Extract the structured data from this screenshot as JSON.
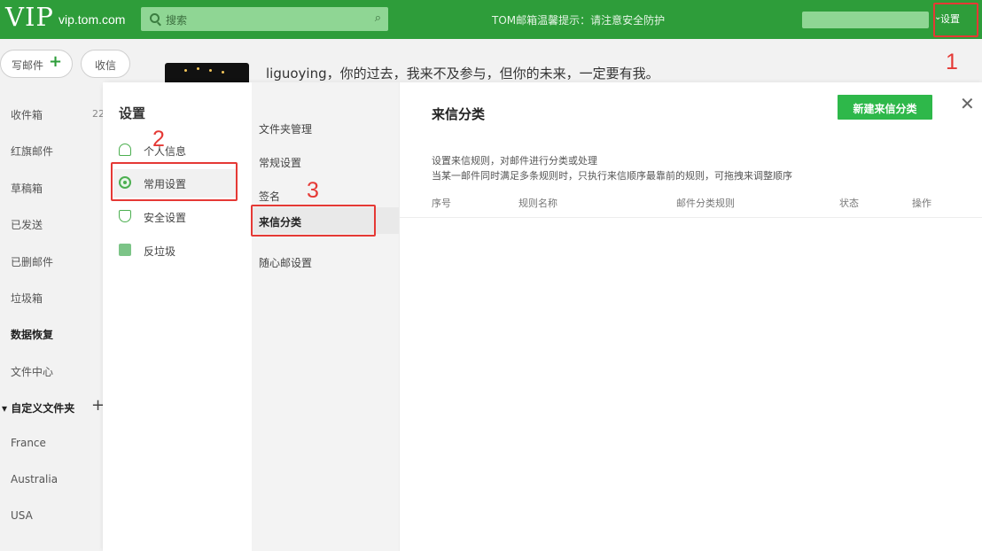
{
  "topbar": {
    "brand": "VIP",
    "domain": "vip.tom.com",
    "search_placeholder": "搜索",
    "notice": "TOM邮箱温馨提示：请注意安全防护",
    "settings_label": "设置",
    "colors": {
      "bar": "#2e9d3a",
      "search_bg": "#8fd694"
    }
  },
  "left": {
    "compose_label": "写邮件",
    "receive_label": "收信",
    "folders": [
      {
        "label": "收件箱",
        "count": "22"
      },
      {
        "label": "红旗邮件"
      },
      {
        "label": "草稿箱"
      },
      {
        "label": "已发送"
      },
      {
        "label": "已删邮件"
      },
      {
        "label": "垃圾箱"
      },
      {
        "label": "数据恢复",
        "bold": true
      },
      {
        "label": "文件中心"
      }
    ],
    "custom_label": "自定义文件夹",
    "custom_folders": [
      "France",
      "Australia",
      "USA"
    ]
  },
  "banner": {
    "text": "liguoying，你的过去，我来不及参与，但你的未来，一定要有我。"
  },
  "settings_modal": {
    "title": "设置",
    "nav": [
      {
        "label": "个人信息",
        "icon": "person-icon"
      },
      {
        "label": "常用设置",
        "icon": "gear-icon",
        "active": true
      },
      {
        "label": "安全设置",
        "icon": "shield-icon"
      },
      {
        "label": "反垃圾",
        "icon": "trash-icon"
      }
    ],
    "sub_nav": [
      {
        "label": "文件夹管理"
      },
      {
        "label": "常规设置"
      },
      {
        "label": "签名"
      },
      {
        "label": "来信分类",
        "active": true
      },
      {
        "label": "随心邮设置"
      }
    ],
    "content": {
      "title": "来信分类",
      "new_button": "新建来信分类",
      "desc_line1": "设置来信规则，对邮件进行分类或处理",
      "desc_line2": "当某一邮件同时满足多条规则时，只执行来信顺序最靠前的规则，可拖拽来调整顺序",
      "columns": [
        "序号",
        "规则名称",
        "邮件分类规则",
        "状态",
        "操作"
      ]
    }
  },
  "annotations": {
    "step1": "1",
    "step2": "2",
    "step3": "3",
    "color": "#e53935"
  }
}
